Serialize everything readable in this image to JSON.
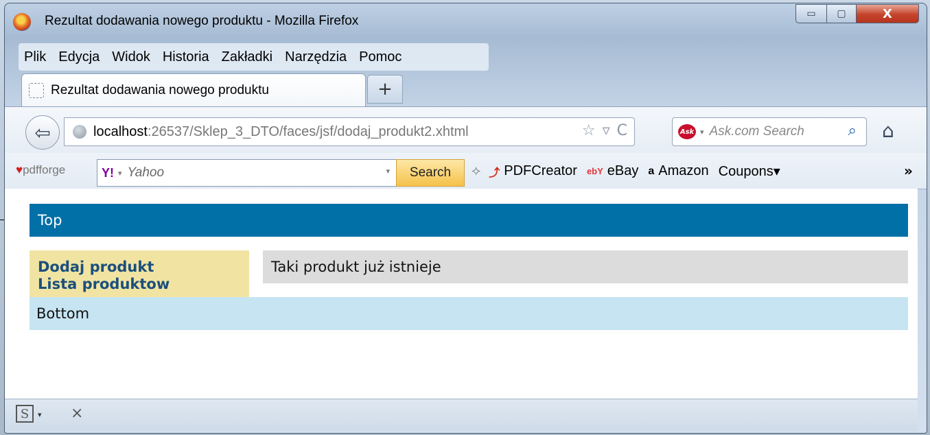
{
  "window": {
    "title": "Rezultat dodawania nowego produktu - Mozilla Firefox",
    "controls": {
      "minimize": "▭",
      "maximize": "▢",
      "close": "X"
    }
  },
  "menubar": {
    "items": [
      "Plik",
      "Edycja",
      "Widok",
      "Historia",
      "Zakładki",
      "Narzędzia",
      "Pomoc"
    ]
  },
  "tabs": {
    "active_label": "Rezultat dodawania nowego produktu",
    "new_tab_label": "+"
  },
  "navbar": {
    "back": "⇦",
    "url_host": "localhost",
    "url_rest": ":26537/Sklep_3_DTO/faces/jsf/dodaj_produkt2.xhtml",
    "url_icons": [
      "☆",
      "▿",
      "C"
    ],
    "search_placeholder": "Ask.com Search",
    "search_engine": "Ask",
    "home": "⌂"
  },
  "toolbar": {
    "pdfforge": "pdfforge",
    "yahoo_logo": "Y!",
    "yahoo_placeholder": "Yahoo",
    "search_button": "Search",
    "links": [
      {
        "icon": "pdf-icon",
        "label": "PDFCreator"
      },
      {
        "icon": "ebay-icon",
        "label": "eBay"
      },
      {
        "icon": "amazon-icon",
        "label": "Amazon"
      },
      {
        "icon": "",
        "label": "Coupons▾"
      }
    ],
    "more": "»"
  },
  "page": {
    "top": "Top",
    "nav_links": [
      "Dodaj produkt",
      "Lista produktow"
    ],
    "message": "Taki produkt już istnieje",
    "bottom": "Bottom"
  },
  "statusbar": {
    "s_icon": "S",
    "s_arrow": "▾",
    "close": "×"
  }
}
